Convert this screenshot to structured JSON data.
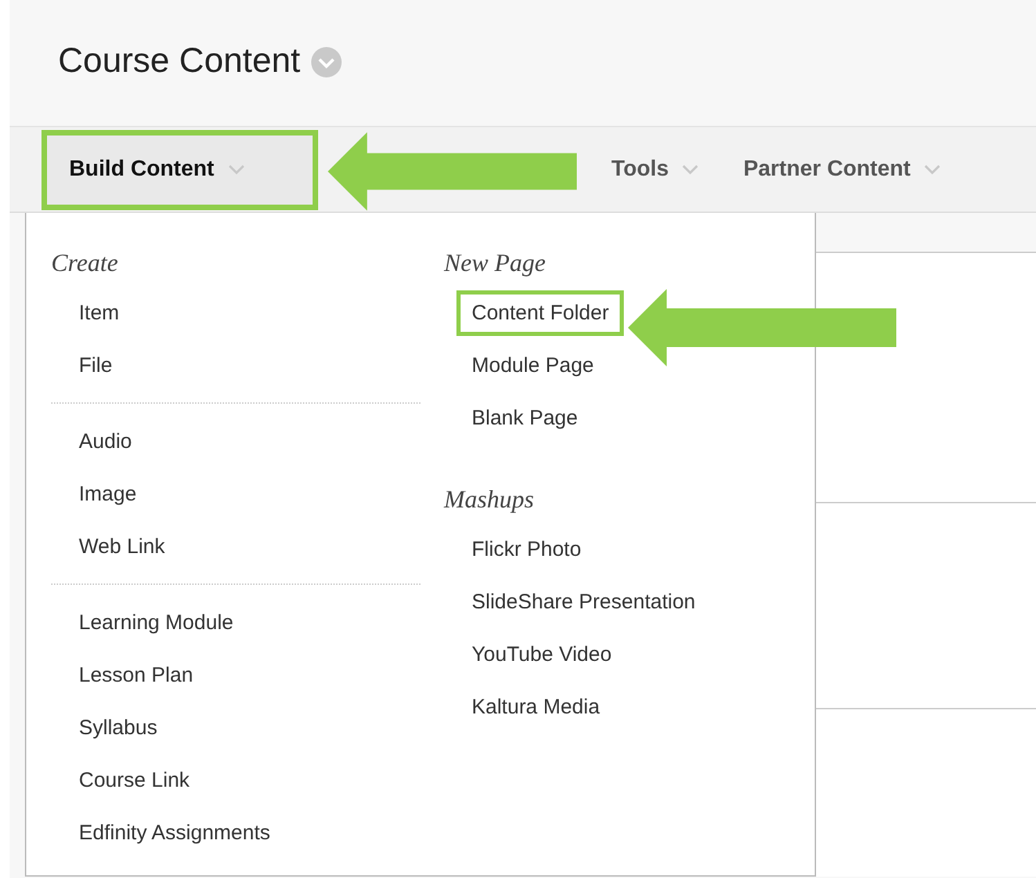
{
  "page": {
    "title": "Course Content"
  },
  "toolbar": [
    {
      "label": "Build Content",
      "open": true,
      "highlighted": true
    },
    {
      "label": "Tools",
      "open": false,
      "highlighted": false
    },
    {
      "label": "Partner Content",
      "open": false,
      "highlighted": false
    }
  ],
  "menu": {
    "columns": [
      {
        "sections": [
          {
            "heading": "Create",
            "groups": [
              [
                {
                  "label": "Item",
                  "highlighted": false
                },
                {
                  "label": "File",
                  "highlighted": false
                }
              ],
              [
                {
                  "label": "Audio",
                  "highlighted": false
                },
                {
                  "label": "Image",
                  "highlighted": false
                },
                {
                  "label": "Web Link",
                  "highlighted": false
                }
              ],
              [
                {
                  "label": "Learning Module",
                  "highlighted": false
                },
                {
                  "label": "Lesson Plan",
                  "highlighted": false
                },
                {
                  "label": "Syllabus",
                  "highlighted": false
                },
                {
                  "label": "Course Link",
                  "highlighted": false
                },
                {
                  "label": "Edfinity Assignments",
                  "highlighted": false
                }
              ]
            ]
          }
        ]
      },
      {
        "sections": [
          {
            "heading": "New Page",
            "groups": [
              [
                {
                  "label": "Content Folder",
                  "highlighted": true
                },
                {
                  "label": "Module Page",
                  "highlighted": false
                },
                {
                  "label": "Blank Page",
                  "highlighted": false
                }
              ]
            ]
          },
          {
            "heading": "Mashups",
            "groups": [
              [
                {
                  "label": "Flickr Photo",
                  "highlighted": false
                },
                {
                  "label": "SlideShare Presentation",
                  "highlighted": false
                },
                {
                  "label": "YouTube Video",
                  "highlighted": false
                },
                {
                  "label": "Kaltura Media",
                  "highlighted": false
                }
              ]
            ]
          }
        ]
      }
    ]
  }
}
